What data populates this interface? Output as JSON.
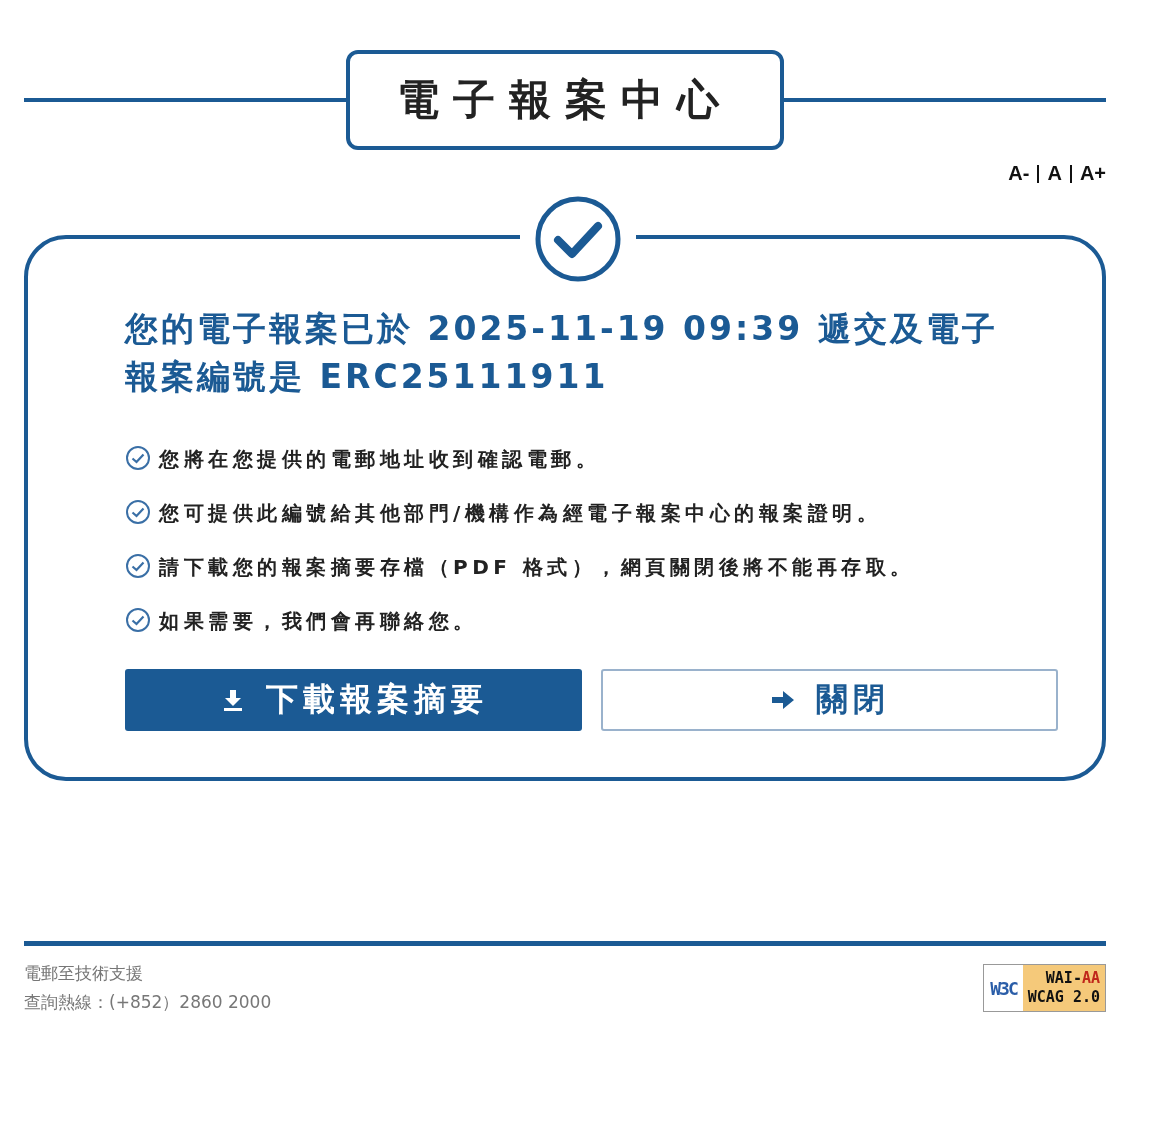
{
  "title": "電子報案中心",
  "font_size_controls": [
    {
      "label": "A-"
    },
    {
      "label": "A"
    },
    {
      "label": "A+"
    }
  ],
  "confirmation": {
    "headline": "您的電子報案已於 2025-11-19 09:39 遞交及電子報案編號是 ERC25111911",
    "notes": [
      "您將在您提供的電郵地址收到確認電郵。",
      "您可提供此編號給其他部門/機構作為經電子報案中心的報案證明。",
      "請下載您的報案摘要存檔（PDF 格式），網頁關閉後將不能再存取。",
      "如果需要，我們會再聯絡您。"
    ],
    "buttons": [
      {
        "kind": "download",
        "label": "下載報案摘要"
      },
      {
        "kind": "close",
        "label": "關閉"
      }
    ]
  },
  "footer": {
    "lines": [
      "電郵至技術支援",
      "查詢熱線：(+852）2860 2000"
    ],
    "badge": {
      "logo": "W3C",
      "wai": "WAI-",
      "conformance": "AA",
      "standard": "WCAG 2.0"
    }
  }
}
